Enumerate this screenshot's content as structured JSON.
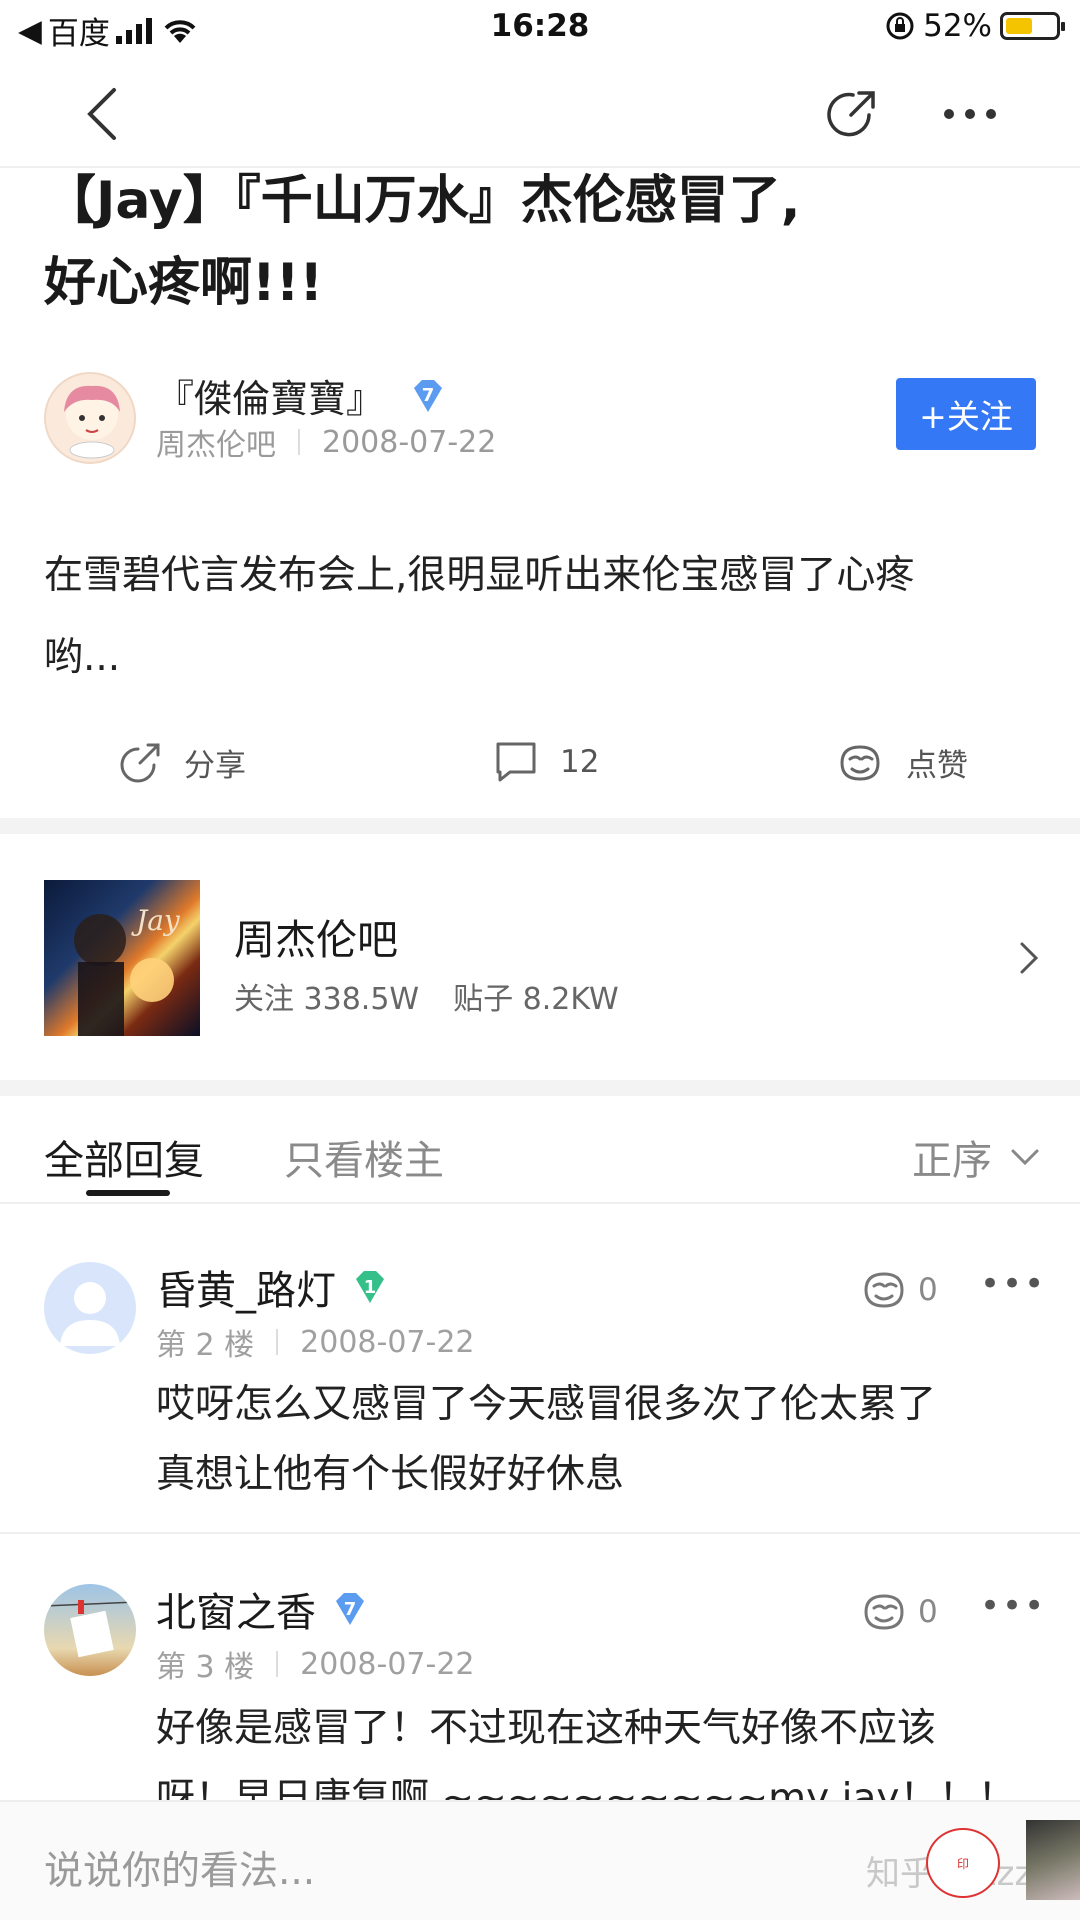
{
  "status_bar": {
    "carrier": "百度",
    "time": "16:28",
    "battery": "52%",
    "battery_level": 0.52
  },
  "nav": {
    "back_icon": "chevron-left-icon",
    "share_icon": "share-icon",
    "more_icon": "more-icon"
  },
  "post": {
    "title_line1": "【Jay】『千山万水』杰伦感冒了,",
    "title_line2": "好心疼啊!!!",
    "author_name": "『傑倫寶寶』",
    "author_level": "7",
    "forum": "周杰伦吧",
    "date": "2008-07-22",
    "follow_label": "+关注",
    "body_line1": "在雪碧代言发布会上,很明显听出来伦宝感冒了心疼",
    "body_line2": "哟..."
  },
  "actions": {
    "share_label": "分享",
    "comment_count": "12",
    "like_label": "点赞"
  },
  "forum_card": {
    "name": "周杰伦吧",
    "followers": "关注 338.5W",
    "posts": "贴子 8.2KW"
  },
  "tabs": {
    "all_replies": "全部回复",
    "op_only": "只看楼主",
    "sort": "正序"
  },
  "replies": [
    {
      "name": "昏黄_路灯",
      "level": "1",
      "floor": "第 2 楼",
      "date": "2008-07-22",
      "likes": "0",
      "text_line1": "哎呀怎么又感冒了今天感冒很多次了伦太累了",
      "text_line2": "真想让他有个长假好好休息"
    },
    {
      "name": "北窗之香",
      "level": "7",
      "floor": "第 3 楼",
      "date": "2008-07-22",
      "likes": "0",
      "text_line1": "好像是感冒了！不过现在这种天气好像不应该",
      "text_line2": "呀！早日康复啊 ~~~~~~~~~~my jay！！！"
    }
  ],
  "bottom_bar": {
    "placeholder": "说说你的看法...",
    "watermark": "知乎 @zzzzz"
  },
  "colors": {
    "accent": "#3478f6",
    "badge_blue": "#5b9bf0",
    "badge_green": "#35c08a"
  }
}
